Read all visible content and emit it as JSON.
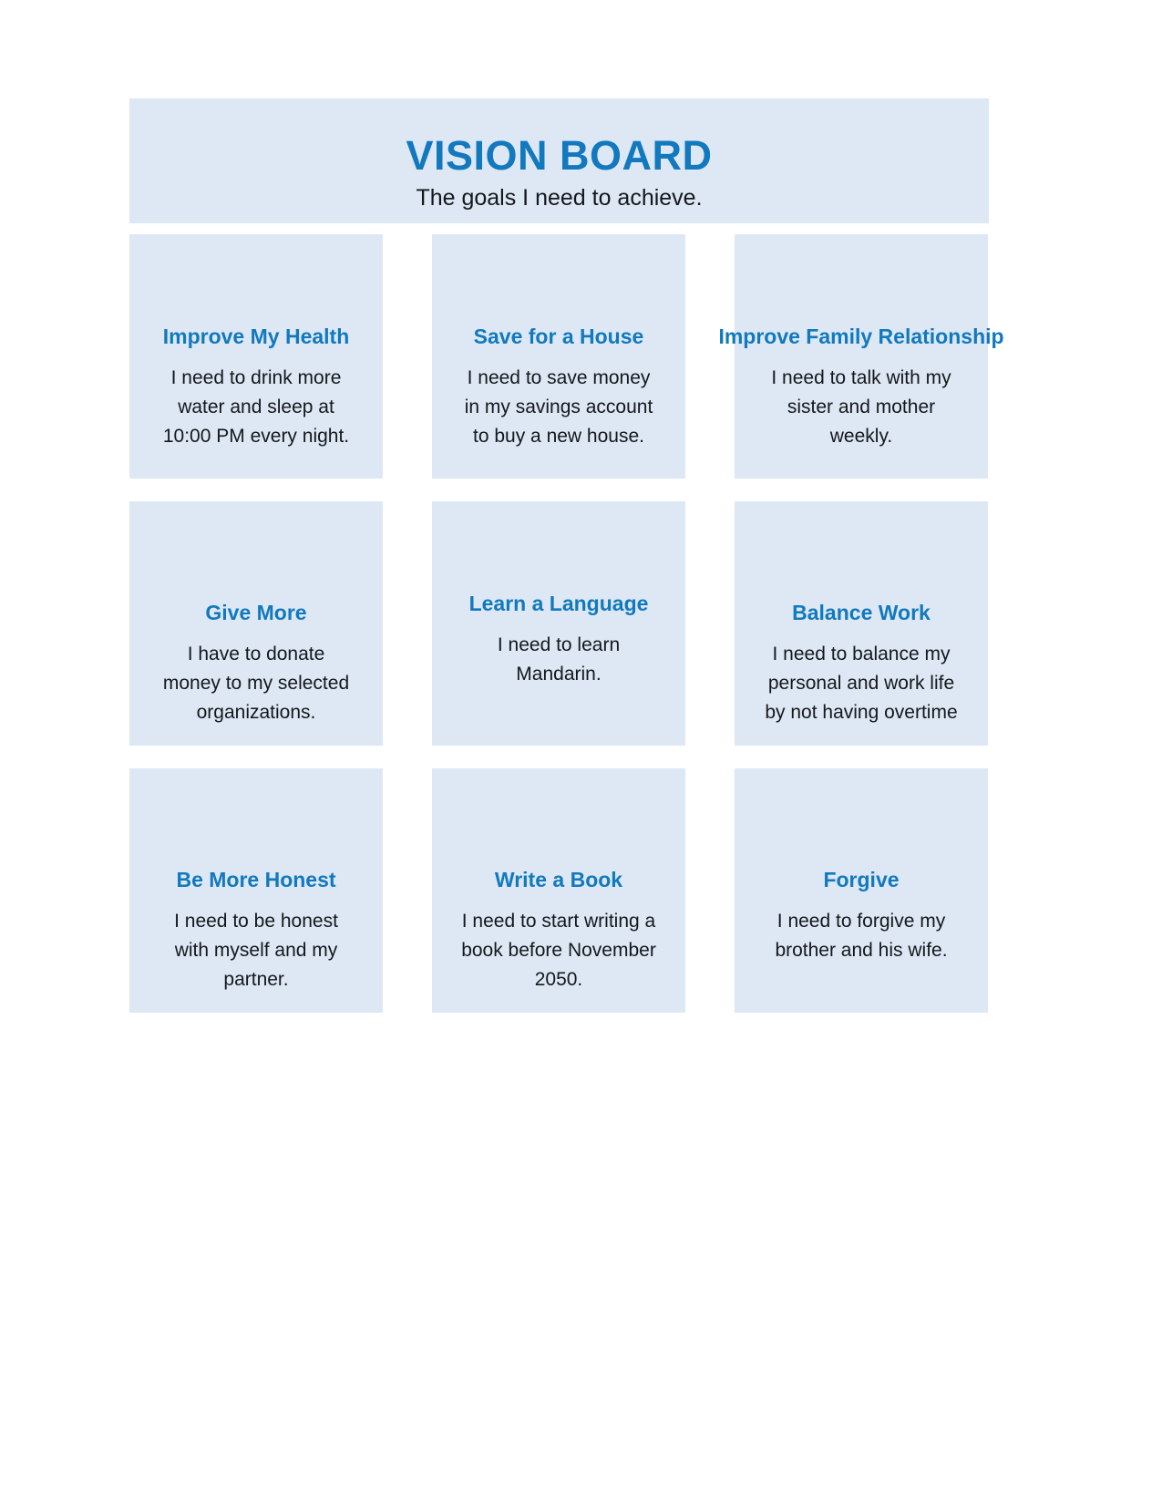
{
  "header": {
    "title": "VISION BOARD",
    "subtitle": "The goals I need to achieve."
  },
  "colors": {
    "card_background": "#dde8f4",
    "accent_blue": "#1279be",
    "body_text": "#14181c",
    "page_background": "#ffffff"
  },
  "cards": [
    {
      "title": "Improve\nMy Health",
      "body": "I need to drink more\nwater and sleep at\n10:00 PM every night.",
      "title_lines": 2
    },
    {
      "title": "Save for a\nHouse",
      "body": "I need to save money\nin my savings account\nto buy a new house.",
      "title_lines": 2
    },
    {
      "title": "Improve Family\nRelationship",
      "body": "I need to talk with my\nsister and mother\nweekly.",
      "title_lines": 2
    },
    {
      "title": "Give More",
      "body": "I have to donate\nmoney to my selected\norganizations.",
      "title_lines": 1
    },
    {
      "title": "Learn a\nLanguage",
      "body": "I need to learn\nMandarin.",
      "title_lines": 2
    },
    {
      "title": "Balance Work",
      "body": "I need to balance my\npersonal and work life\nby not having overtime",
      "title_lines": 1
    },
    {
      "title": "Be More Honest",
      "body": "I need to be honest\nwith myself and my\npartner.",
      "title_lines": 1
    },
    {
      "title": "Write a Book",
      "body": "I need to start writing a\nbook before November\n2050.",
      "title_lines": 1
    },
    {
      "title": "Forgive",
      "body": "I need to forgive my\nbrother and his wife.",
      "title_lines": 1
    }
  ]
}
